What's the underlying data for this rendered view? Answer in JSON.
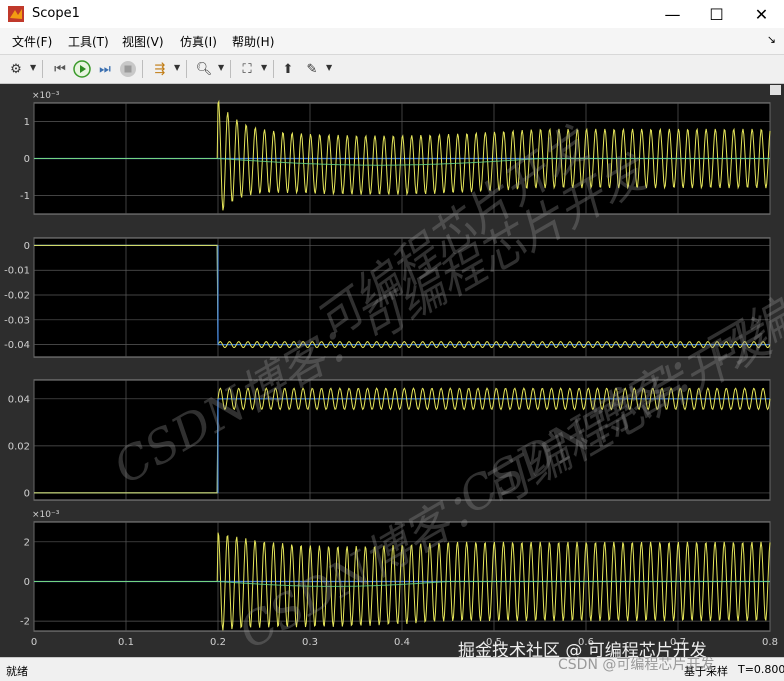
{
  "window": {
    "title": "Scope1",
    "controls": [
      "minimize-icon",
      "maximize-icon",
      "close-icon"
    ]
  },
  "menu": [
    "文件(F)",
    "工具(T)",
    "视图(V)",
    "仿真(I)",
    "帮助(H)"
  ],
  "toolbar": {
    "buttons": [
      "gear-icon",
      "step-back-icon",
      "run-icon",
      "step-forward-icon",
      "stop-icon",
      "highlight-icon",
      "zoom-icon",
      "autoscale-icon",
      "style-icon",
      "measure-icon"
    ]
  },
  "colors": {
    "axes_background": "#000000",
    "figure_background": "#2d2d2d",
    "grid": "#5a5a5a",
    "series_yellow": "#e6e65a",
    "series_blue": "#3c7dd9",
    "series_green": "#5fd08a"
  },
  "chart_data": [
    {
      "type": "line",
      "title": "",
      "exponent": "×10⁻³",
      "yticks": [
        "1",
        "0",
        "-1"
      ],
      "ylim": [
        -1.5,
        1.5
      ],
      "xlim": [
        0,
        0.8
      ],
      "series": [
        {
          "color": "#3c7dd9",
          "description": "zero until t=0.2"
        },
        {
          "color": "#e6e65a",
          "description": "oscillation from t=0.2, initial peak ~1.5, amplitude ~0.8"
        },
        {
          "color": "#5fd08a",
          "description": "mean trace dipping to ~-0.2 then returning to 0"
        }
      ]
    },
    {
      "type": "line",
      "yticks": [
        "0",
        "-0.01",
        "-0.02",
        "-0.03",
        "-0.04"
      ],
      "ylim": [
        -0.045,
        0.003
      ],
      "xlim": [
        0,
        0.8
      ],
      "series": [
        {
          "color": "#3c7dd9",
          "description": "0 until t=0.2, then steps to -0.04"
        },
        {
          "color": "#e6e65a",
          "description": "small oscillation around -0.04 after t=0.2"
        }
      ]
    },
    {
      "type": "line",
      "yticks": [
        "0.04",
        "0.02",
        "0"
      ],
      "ylim": [
        -0.003,
        0.048
      ],
      "xlim": [
        0,
        0.8
      ],
      "series": [
        {
          "color": "#3c7dd9",
          "description": "0 until t=0.2, then steps to 0.04"
        },
        {
          "color": "#e6e65a",
          "description": "oscillation around 0.04 after t=0.2"
        }
      ]
    },
    {
      "type": "line",
      "exponent": "×10⁻³",
      "yticks": [
        "2",
        "0",
        "-2"
      ],
      "ylim": [
        -2.5,
        3.0
      ],
      "xlim": [
        0,
        0.8
      ],
      "xticks": [
        "0",
        "0.1",
        "0.2",
        "0.3",
        "0.4",
        "0.5",
        "0.6",
        "0.7",
        "0.8"
      ],
      "series": [
        {
          "color": "#3c7dd9",
          "description": "zero until t=0.2"
        },
        {
          "color": "#e6e65a",
          "description": "oscillation from t=0.2, amplitude ~2"
        },
        {
          "color": "#5fd08a",
          "description": "mean trace dipping slightly then returning to 0"
        }
      ]
    }
  ],
  "watermarks": {
    "diagonal": [
      "可编程芯片开发",
      "CSDN博客：可编程芯片开发",
      "CSDN博客：可编程芯片开发",
      "CSDN博客：可编程芯片开发"
    ],
    "bottom": "掘金技术社区 @ 可编程芯片开发",
    "bottom2": "CSDN @可编程芯片开发"
  },
  "status": {
    "ready": "就绪",
    "mode": "基于采样",
    "time": "T=0.800"
  }
}
